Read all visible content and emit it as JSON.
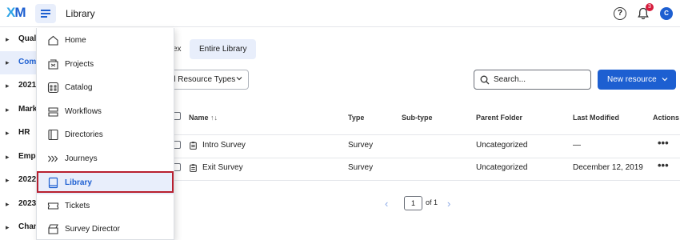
{
  "app": {
    "logo_x": "X",
    "logo_m": "M",
    "title": "Library",
    "help_glyph": "?",
    "notification_count": "3",
    "avatar_initial": "C"
  },
  "sidebar": {
    "items": [
      {
        "label": "Qual"
      },
      {
        "label": "Com"
      },
      {
        "label": "2021"
      },
      {
        "label": "Mark"
      },
      {
        "label": "HR"
      },
      {
        "label": "Emp"
      },
      {
        "label": "2022"
      },
      {
        "label": "2023"
      },
      {
        "label": "Chan"
      }
    ]
  },
  "nav_menu": {
    "items": [
      {
        "label": "Home"
      },
      {
        "label": "Projects"
      },
      {
        "label": "Catalog"
      },
      {
        "label": "Workflows"
      },
      {
        "label": "Directories"
      },
      {
        "label": "Journeys"
      },
      {
        "label": "Library"
      },
      {
        "label": "Tickets"
      },
      {
        "label": "Survey Director"
      }
    ],
    "selected": "Library"
  },
  "tabs": {
    "partial_label": "ex",
    "entire_label": "Entire Library"
  },
  "filter": {
    "selected": "ll Resource Types"
  },
  "search": {
    "placeholder": "Search..."
  },
  "new_resource_label": "New resource",
  "table": {
    "headers": {
      "name": "Name",
      "sort_glyph": "↑↓",
      "type": "Type",
      "subtype": "Sub-type",
      "folder": "Parent Folder",
      "modified": "Last Modified",
      "actions": "Actions"
    },
    "rows": [
      {
        "name": "Intro Survey",
        "type": "Survey",
        "subtype": "",
        "folder": "Uncategorized",
        "modified": "—",
        "actions": "•••"
      },
      {
        "name": "Exit Survey",
        "type": "Survey",
        "subtype": "",
        "folder": "Uncategorized",
        "modified": "December 12, 2019",
        "actions": "•••"
      }
    ]
  },
  "pagination": {
    "current": "1",
    "of_label": "of 1"
  },
  "colors": {
    "accent": "#1d5fd1",
    "highlight": "#b8202f",
    "selected_bg": "#e8eefb"
  }
}
